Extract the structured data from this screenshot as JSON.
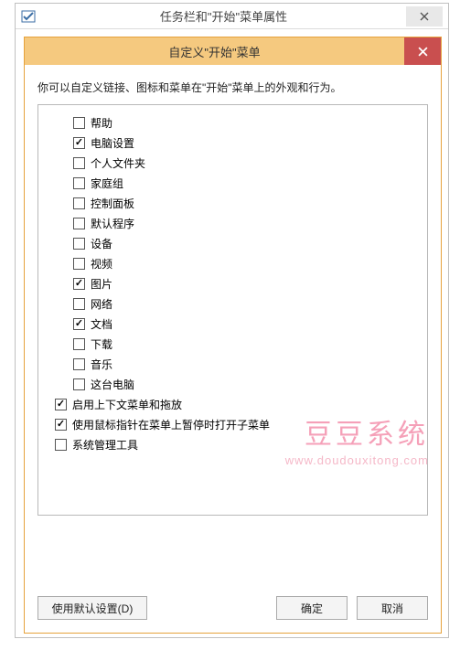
{
  "outer": {
    "title": "任务栏和\"开始\"菜单属性"
  },
  "inner": {
    "title": "自定义\"开始\"菜单"
  },
  "description": "你可以自定义链接、图标和菜单在\"开始\"菜单上的外观和行为。",
  "items": [
    {
      "label": "帮助",
      "checked": false,
      "indent": 1
    },
    {
      "label": "电脑设置",
      "checked": true,
      "indent": 1
    },
    {
      "label": "个人文件夹",
      "checked": false,
      "indent": 1
    },
    {
      "label": "家庭组",
      "checked": false,
      "indent": 1
    },
    {
      "label": "控制面板",
      "checked": false,
      "indent": 1
    },
    {
      "label": "默认程序",
      "checked": false,
      "indent": 1
    },
    {
      "label": "设备",
      "checked": false,
      "indent": 1
    },
    {
      "label": "视频",
      "checked": false,
      "indent": 1
    },
    {
      "label": "图片",
      "checked": true,
      "indent": 1
    },
    {
      "label": "网络",
      "checked": false,
      "indent": 1
    },
    {
      "label": "文档",
      "checked": true,
      "indent": 1
    },
    {
      "label": "下载",
      "checked": false,
      "indent": 1
    },
    {
      "label": "音乐",
      "checked": false,
      "indent": 1
    },
    {
      "label": "这台电脑",
      "checked": false,
      "indent": 1
    },
    {
      "label": "启用上下文菜单和拖放",
      "checked": true,
      "indent": 0
    },
    {
      "label": "使用鼠标指针在菜单上暂停时打开子菜单",
      "checked": true,
      "indent": 0
    },
    {
      "label": "系统管理工具",
      "checked": false,
      "indent": 0
    }
  ],
  "buttons": {
    "defaults": "使用默认设置(D)",
    "ok": "确定",
    "cancel": "取消"
  },
  "watermark": {
    "text": "豆豆系统",
    "url": "www.doudouxitong.com"
  }
}
